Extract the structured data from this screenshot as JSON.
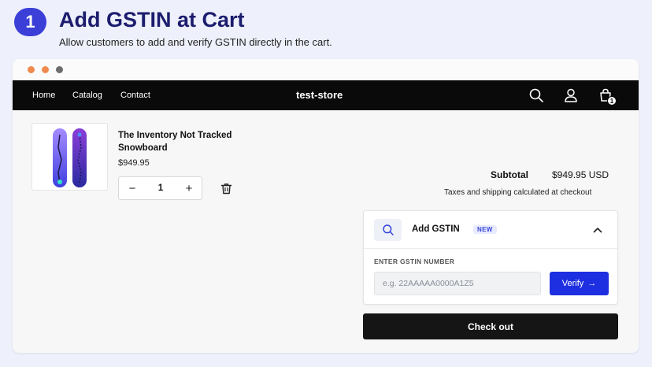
{
  "hero": {
    "step": "1",
    "title": "Add GSTIN at Cart",
    "subtitle": "Allow customers to add and verify GSTIN directly in the cart."
  },
  "store": {
    "nav": [
      "Home",
      "Catalog",
      "Contact"
    ],
    "name": "test-store",
    "cart_count": "1",
    "icons": [
      "search-icon",
      "account-icon",
      "cart-icon"
    ]
  },
  "cart": {
    "product_title": "The Inventory Not Tracked Snowboard",
    "product_price": "$949.95",
    "quantity": "1",
    "minus": "−",
    "plus": "+",
    "subtotal_label": "Subtotal",
    "subtotal_value": "$949.95 USD",
    "tax_note": "Taxes and shipping calculated at checkout",
    "checkout_label": "Check out"
  },
  "gstin": {
    "title": "Add GSTIN",
    "badge": "NEW",
    "field_label": "ENTER GSTIN NUMBER",
    "placeholder": "e.g. 22AAAAA0000A1Z5",
    "verify_label": "Verify",
    "verify_arrow": "→"
  },
  "colors": {
    "accent": "#1d2fe0",
    "hero_title": "#1c1d6e",
    "badge": "#3b3fd8",
    "store_bar": "#0a0a0a",
    "window_dots": [
      "#ef8b4e",
      "#ef8b4e",
      "#6d6d6d"
    ]
  }
}
